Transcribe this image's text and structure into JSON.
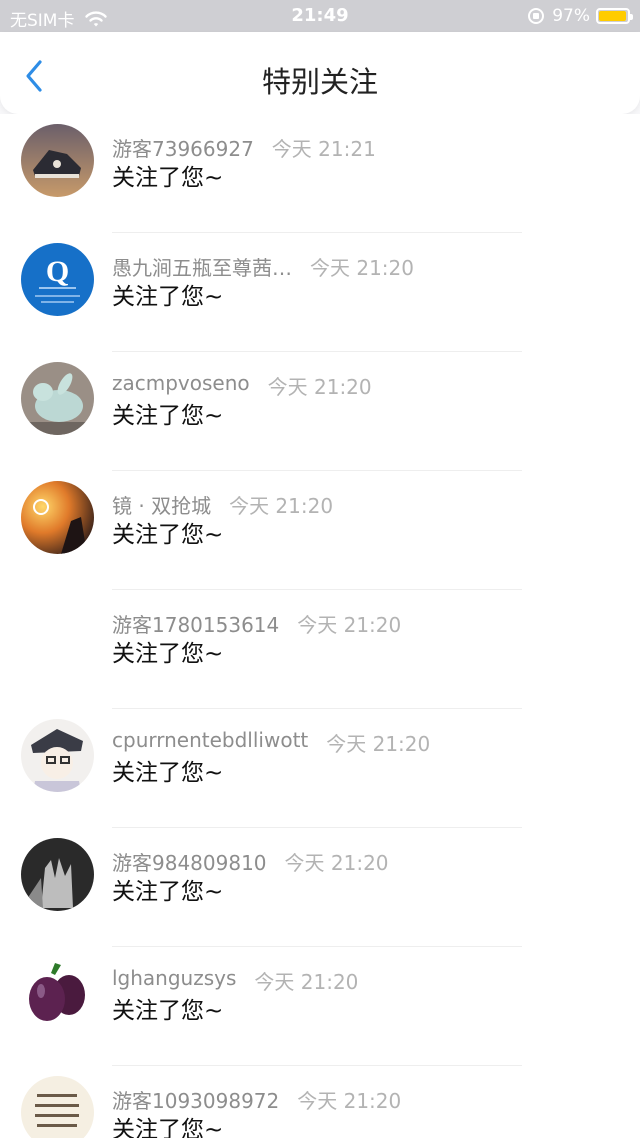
{
  "status_bar": {
    "carrier": "无SIM卡",
    "time": "21:49",
    "battery": "97%",
    "battery_level": 0.97,
    "battery_color": "#ffcc00"
  },
  "nav": {
    "title": "特别关注",
    "back_icon": "chevron-left-icon",
    "accent_color": "#2e8de6"
  },
  "items": [
    {
      "name": "游客73966927",
      "time": "今天 21:21",
      "action": "关注了您~"
    },
    {
      "name": "愚九涧五瓶至尊茜…",
      "time": "今天 21:20",
      "action": "关注了您~"
    },
    {
      "name": "zacmpvoseno",
      "time": "今天 21:20",
      "action": "关注了您~"
    },
    {
      "name": "镜 · 双抢城",
      "time": "今天 21:20",
      "action": "关注了您~"
    },
    {
      "name": "游客1780153614",
      "time": "今天 21:20",
      "action": "关注了您~"
    },
    {
      "name": "cpurrnentebdlliwott",
      "time": "今天 21:20",
      "action": "关注了您~"
    },
    {
      "name": "游客984809810",
      "time": "今天 21:20",
      "action": "关注了您~"
    },
    {
      "name": "lghanguzsys",
      "time": "今天 21:20",
      "action": "关注了您~"
    },
    {
      "name": "游客1093098972",
      "time": "今天 21:20",
      "action": "关注了您~"
    }
  ],
  "avatar_logo_text": "Q"
}
